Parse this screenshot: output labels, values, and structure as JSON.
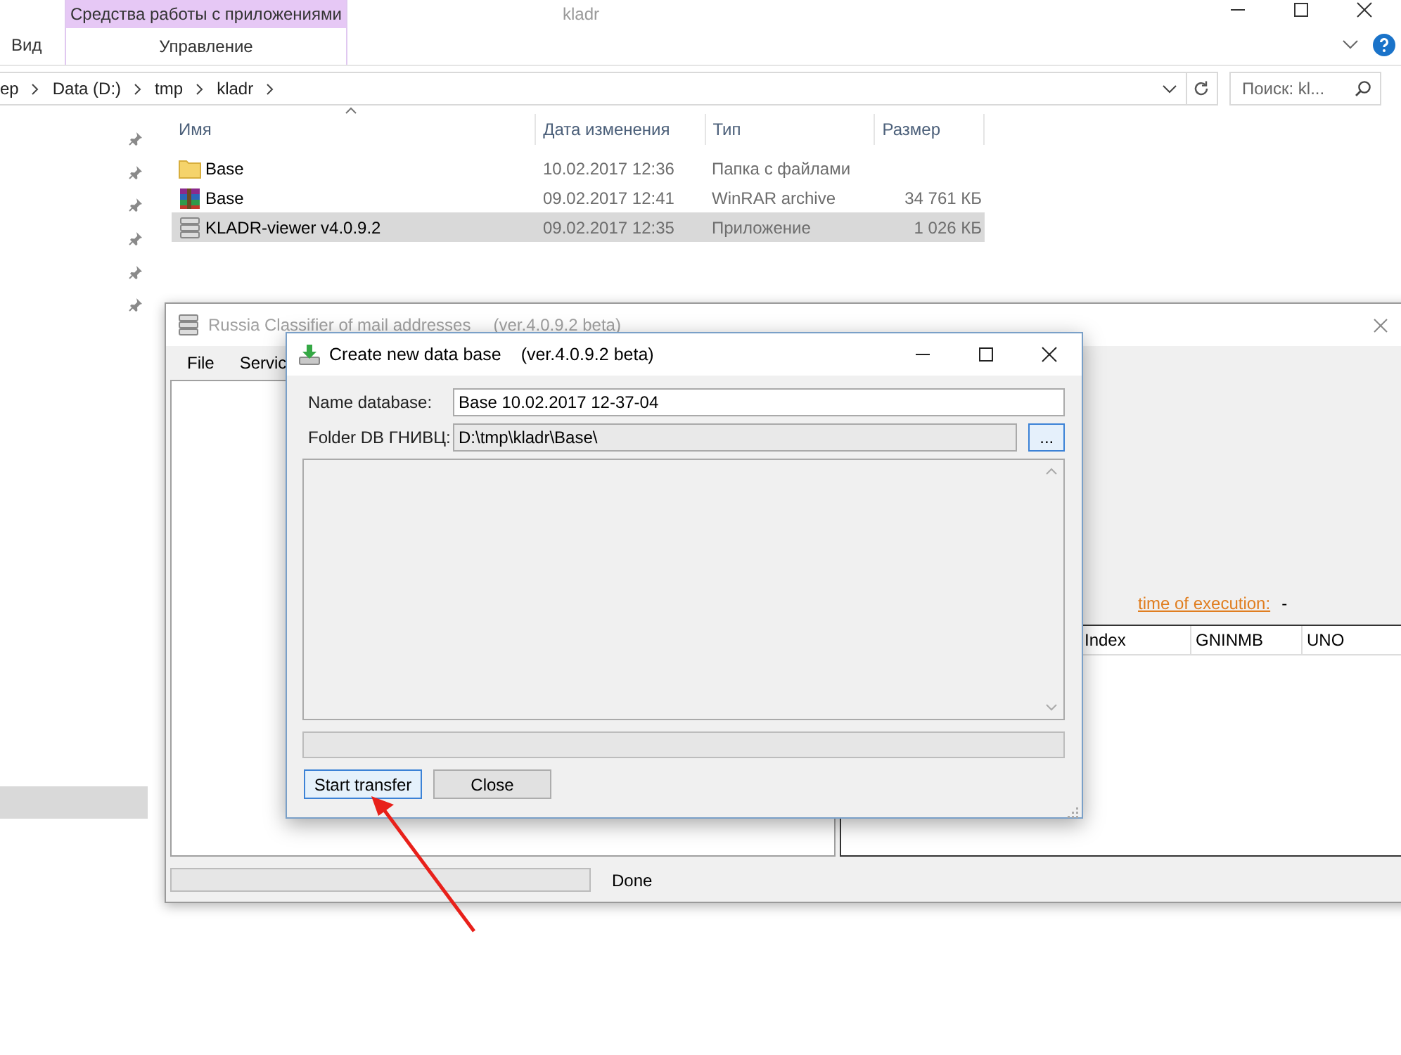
{
  "explorer": {
    "title": "kladr",
    "ribbon_tabs": [
      {
        "label": "Вид",
        "selected": false
      }
    ],
    "contextual_group": {
      "title": "Средства работы с приложениями",
      "tab": {
        "label": "Управление",
        "selected": false
      }
    },
    "breadcrumb": [
      "ep",
      "Data (D:)",
      "tmp",
      "kladr"
    ],
    "search": {
      "placeholder": "Поиск: kl..."
    },
    "columns": [
      "Имя",
      "Дата изменения",
      "Тип",
      "Размер"
    ],
    "nav_items": [
      {
        "pinned": true,
        "selected": false
      },
      {
        "pinned": true,
        "selected": false
      },
      {
        "pinned": true,
        "selected": false
      },
      {
        "pinned": true,
        "selected": false
      },
      {
        "pinned": true,
        "selected": false
      },
      {
        "pinned": true,
        "selected": false
      },
      {
        "pinned": false,
        "selected": true
      }
    ],
    "files": [
      {
        "kind": "folder",
        "name": "Base",
        "date": "10.02.2017 12:36",
        "type": "Папка с файлами",
        "selected": false
      },
      {
        "kind": "archive",
        "name": "Base",
        "date": "09.02.2017 12:41",
        "type": "WinRAR archive",
        "size": "34 761 КБ",
        "selected": false
      },
      {
        "kind": "app",
        "name": "KLADR-viewer v4.0.9.2",
        "date": "09.02.2017 12:35",
        "type": "Приложение",
        "size": "1 026 КБ",
        "selected": true
      }
    ]
  },
  "app": {
    "title": "Russia Classifier of mail addresses",
    "version": "(ver.4.0.9.2 beta)",
    "active": false,
    "menu": [
      "File",
      "Servic"
    ],
    "time_label": "time of execution:",
    "time_value": "-",
    "table_columns": [
      "Index",
      "GNINMB",
      "UNO"
    ],
    "progress": {
      "level": 0
    },
    "status": "Done"
  },
  "dialog": {
    "title": "Create new data base",
    "version": "(ver.4.0.9.2 beta)",
    "fields": [
      {
        "label": "Name database:",
        "value": "Base 10.02.2017 12-37-04",
        "disabled": false
      },
      {
        "label": "Folder DB ГНИВЦ:",
        "value": "D:\\tmp\\kladr\\Base\\",
        "disabled": true,
        "browse": "..."
      }
    ],
    "progress": {
      "level": 0
    },
    "buttons": [
      {
        "label": "Start transfer",
        "focused": true
      },
      {
        "label": "Close",
        "focused": false
      }
    ]
  }
}
